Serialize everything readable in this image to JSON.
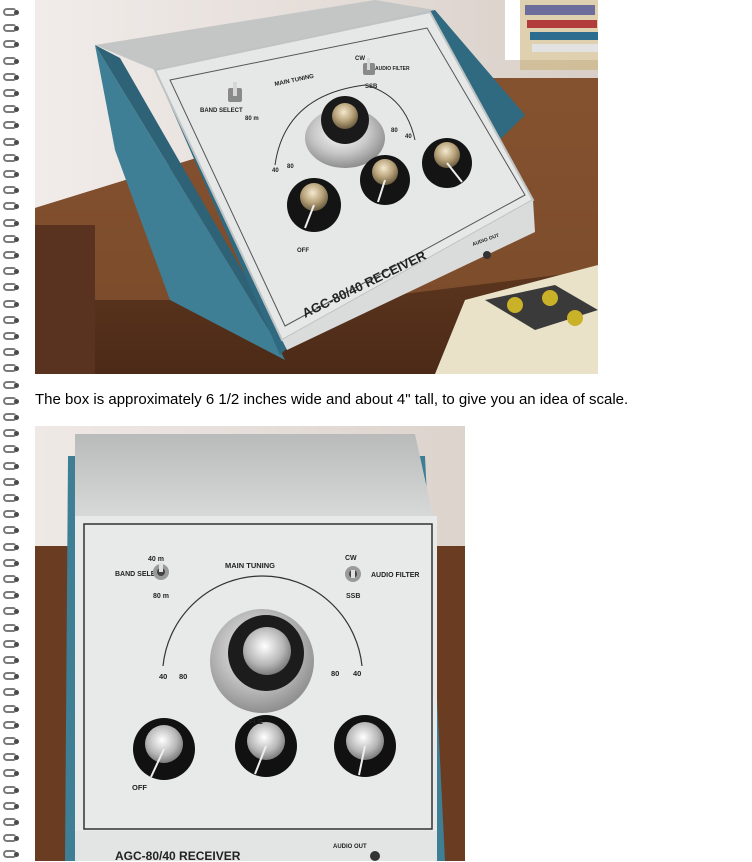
{
  "caption": "The box is approximately 6 1/2 inches wide and about 4\" tall, to give you an idea of scale.",
  "photo1": {
    "device_title": "AGC-80/40 RECEIVER",
    "band_select": "BAND SELECT",
    "band_80": "80 m",
    "main_tuning": "MAIN TUNING",
    "cw": "CW",
    "audio_filter": "AUDIO FILTER",
    "ssb": "SSB",
    "scale_left_40": "40",
    "scale_left_80": "80",
    "scale_right_80": "80",
    "scale_right_40": "40",
    "off": "OFF",
    "audio_out": "AUDIO OUT"
  },
  "photo2": {
    "device_title": "AGC-80/40 RECEIVER",
    "band_select": "BAND SELECT",
    "band_40": "40 m",
    "band_80": "80 m",
    "main_tuning": "MAIN TUNING",
    "cw": "CW",
    "audio_filter": "AUDIO FILTER",
    "ssb": "SSB",
    "scale_left_40": "40",
    "scale_left_80": "80",
    "scale_right_80": "80",
    "scale_right_40": "40",
    "off": "OFF",
    "audio_out": "AUDIO OUT",
    "fine_tune_partial": "FI     E"
  },
  "colors": {
    "panel": "#e9ebea",
    "case_teal": "#3f7f95",
    "wood": "#6b3f24",
    "wall": "#ece7e3"
  }
}
